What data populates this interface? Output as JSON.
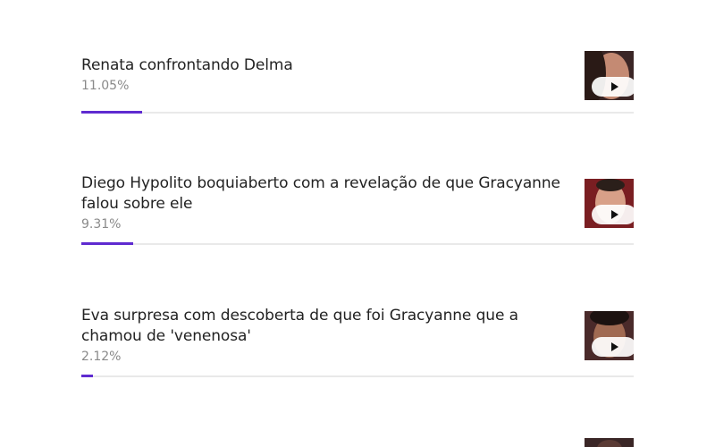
{
  "ranking": {
    "items": [
      {
        "title": "Renata confrontando Delma",
        "percent_label": "11.05%",
        "percent_value": 11.05,
        "thumbnail_icon": "video-thumbnail"
      },
      {
        "title": "Diego Hypolito boquiaberto com a revelação de que Gracyanne falou sobre ele",
        "percent_label": "9.31%",
        "percent_value": 9.31,
        "thumbnail_icon": "video-thumbnail"
      },
      {
        "title": "Eva surpresa com descoberta de que foi Gracyanne que a chamou de 'venenosa'",
        "percent_label": "2.12%",
        "percent_value": 2.12,
        "thumbnail_icon": "video-thumbnail"
      }
    ]
  },
  "colors": {
    "accent": "#5f2bd0",
    "track": "#e9e9e9",
    "title": "#222222",
    "percent": "#8a8a8a"
  }
}
